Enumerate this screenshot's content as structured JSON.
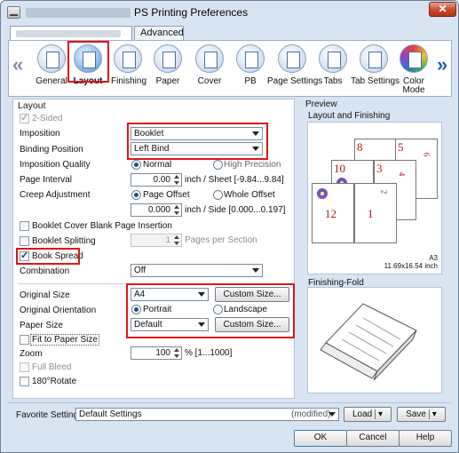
{
  "window": {
    "title": "PS Printing Preferences",
    "close_label": "✕"
  },
  "tabs": [
    {
      "label": ""
    },
    {
      "label": "Advanced"
    }
  ],
  "toolbar": {
    "items": [
      {
        "label": "General",
        "icon": "printer-icon"
      },
      {
        "label": "Layout",
        "icon": "layout-icon",
        "active": true
      },
      {
        "label": "Finishing",
        "icon": "finishing-icon"
      },
      {
        "label": "Paper",
        "icon": "paper-icon"
      },
      {
        "label": "Cover",
        "icon": "cover-icon"
      },
      {
        "label": "PB",
        "icon": "pb-icon"
      },
      {
        "label": "Page Settings",
        "icon": "page-settings-icon"
      },
      {
        "label": "Tabs",
        "icon": "tabs-icon"
      },
      {
        "label": "Tab Settings",
        "icon": "tab-settings-icon"
      },
      {
        "label": "Color Mode",
        "icon": "color-mode-icon"
      }
    ]
  },
  "layout": {
    "section_title": "Layout",
    "two_sided": "2-Sided",
    "imposition_label": "Imposition",
    "imposition_value": "Booklet",
    "binding_label": "Binding Position",
    "binding_value": "Left Bind",
    "quality_label": "Imposition Quality",
    "quality_normal": "Normal",
    "quality_high": "High Precision",
    "page_interval_label": "Page Interval",
    "page_interval_value": "0.00",
    "page_interval_unit": "inch / Sheet [-9.84...9.84]",
    "creep_label": "Creep Adjustment",
    "creep_page_offset": "Page Offset",
    "creep_whole_offset": "Whole Offset",
    "creep_value": "0.000",
    "creep_unit": "inch / Side [0.000...0.197]",
    "booklet_cover_blank": "Booklet Cover Blank Page Insertion",
    "booklet_splitting": "Booklet Splitting",
    "pages_per_section_value": "1",
    "pages_per_section_unit": "Pages per Section",
    "book_spread": "Book Spread",
    "combination_label": "Combination",
    "combination_value": "Off",
    "original_size_label": "Original Size",
    "original_size_value": "A4",
    "custom_size_btn": "Custom Size...",
    "orientation_label": "Original Orientation",
    "orientation_portrait": "Portrait",
    "orientation_landscape": "Landscape",
    "paper_size_label": "Paper Size",
    "paper_size_value": "Default",
    "custom_size_btn2": "Custom Size...",
    "fit_to_paper": "Fit to Paper Size",
    "zoom_label": "Zoom",
    "zoom_value": "100",
    "zoom_unit": "% [1...1000]",
    "full_bleed": "Full Bleed",
    "rotate_180": "180°Rotate"
  },
  "preview": {
    "title": "Preview",
    "subtitle": "Layout and Finishing",
    "pages": [
      "8",
      "5",
      "10",
      "3",
      "12",
      "1",
      "6",
      "4",
      "2"
    ],
    "paper_size_line1": "A3",
    "paper_size_line2": "11.69x16.54 inch",
    "finishing_title": "Finishing-Fold"
  },
  "footer": {
    "favorite_label": "Favorite Setting",
    "favorite_value": "Default Settings",
    "modified": "(modified)",
    "load": "Load",
    "save": "Save",
    "ok": "OK",
    "cancel": "Cancel",
    "help": "Help"
  },
  "colors": {
    "highlight": "#e0141b",
    "accent": "#1d4f9a",
    "page_number": "#b01818"
  }
}
